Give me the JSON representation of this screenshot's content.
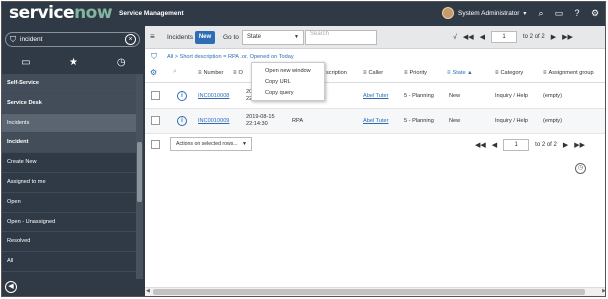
{
  "banner": {
    "logo_text": "service",
    "logo_o": "now",
    "app_name": "Service Management",
    "user_name": "System Administrator",
    "icons": [
      "search-icon",
      "chat-icon",
      "help-icon",
      "gear-icon"
    ]
  },
  "nav": {
    "filter_value": "incident",
    "tabs": [
      "all-apps-icon",
      "favorites-star-icon",
      "history-clock-icon"
    ],
    "items": [
      {
        "label": "Self-Service",
        "kind": "section"
      },
      {
        "label": "Service Desk",
        "kind": "section"
      },
      {
        "label": "Incidents",
        "kind": "active"
      },
      {
        "label": "Incident",
        "kind": "section"
      },
      {
        "label": "Create New",
        "kind": "item"
      },
      {
        "label": "Assigned to me",
        "kind": "item"
      },
      {
        "label": "Open",
        "kind": "item"
      },
      {
        "label": "Open - Unassigned",
        "kind": "item"
      },
      {
        "label": "Resolved",
        "kind": "item"
      },
      {
        "label": "All",
        "kind": "item"
      }
    ]
  },
  "listbar": {
    "title": "Incidents",
    "new_label": "New",
    "goto_label": "Go to",
    "goto_value": "State",
    "search_placeholder": "Search",
    "page_value": "1",
    "page_of": "to 2 of 2"
  },
  "breadcrumb": {
    "text": "All > Short description = RPA .or. Opened on Today"
  },
  "columns": {
    "number": "Number",
    "opened": "O",
    "short_description": "scription",
    "caller": "Caller",
    "priority": "Priority",
    "state": "State",
    "category": "Category",
    "assignment_group": "Assignment group"
  },
  "rows": [
    {
      "number": "INC0010008",
      "opened_line1": "201",
      "opened_line2": "22:1",
      "short_description": "",
      "caller": "Abel Tuter",
      "priority": "5 - Planning",
      "state": "New",
      "category": "Inquiry / Help",
      "assignment_group": "(empty)"
    },
    {
      "number": "INC0010009",
      "opened_line1": "2019-08-15",
      "opened_line2": "22:14:30",
      "short_description": "RPA",
      "caller": "Abel Tuter",
      "priority": "5 - Planning",
      "state": "New",
      "category": "Inquiry / Help",
      "assignment_group": "(empty)"
    }
  ],
  "footer": {
    "actions_label": "Actions on selected rows...",
    "page_value": "1",
    "page_of": "to 2 of 2"
  },
  "context_menu": {
    "items": [
      "Open new window",
      "Copy URL",
      "Copy query"
    ]
  }
}
